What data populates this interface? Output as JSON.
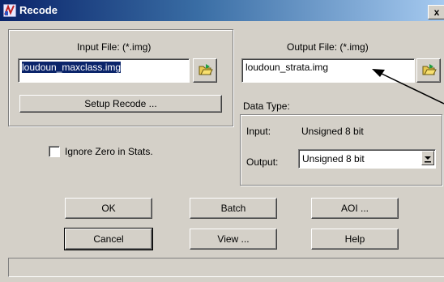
{
  "window": {
    "title": "Recode",
    "close_glyph": "x"
  },
  "input": {
    "label": "Input File: (*.img)",
    "value": "loudoun_maxclass.img"
  },
  "output": {
    "label": "Output File: (*.img)",
    "value": "loudoun_strata.img"
  },
  "setup_recode_label": "Setup Recode ...",
  "data_type": {
    "label": "Data Type:",
    "input_label": "Input:",
    "input_value": "Unsigned 8 bit",
    "output_label": "Output:",
    "output_selected": "Unsigned 8 bit"
  },
  "ignore_zero": {
    "label": "Ignore Zero in Stats.",
    "checked": false
  },
  "buttons": {
    "ok": "OK",
    "batch": "Batch",
    "aoi": "AOI ...",
    "cancel": "Cancel",
    "view": "View ...",
    "help": "Help"
  },
  "icons": {
    "app": "recode-app-icon",
    "folder": "folder-open-icon",
    "arrow": "annotation-arrow"
  }
}
